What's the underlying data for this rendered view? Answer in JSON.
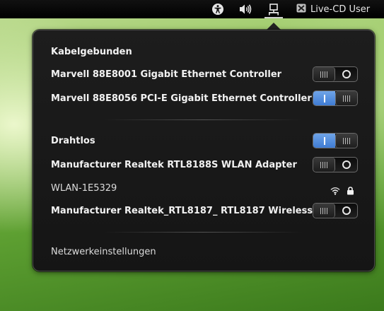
{
  "topbar": {
    "user_label": "Live-CD User"
  },
  "menu": {
    "wired_heading": "Kabelgebunden",
    "wired_devices": [
      {
        "label": "Marvell 88E8001 Gigabit Ethernet Controller",
        "enabled": false
      },
      {
        "label": "Marvell 88E8056 PCI-E Gigabit Ethernet Controller",
        "enabled": true
      }
    ],
    "wireless_heading": "Drahtlos",
    "wireless_enabled": true,
    "wireless_devices": [
      {
        "label": "Manufacturer Realtek RTL8188S WLAN Adapter",
        "enabled": false
      },
      {
        "label": "Manufacturer Realtek_RTL8187_ RTL8187 Wireless",
        "enabled": false
      }
    ],
    "network_name": "WLAN-1E5329",
    "settings_label": "Netzwerkeinstellungen"
  },
  "icons": {
    "accessibility": "accessibility-icon",
    "volume": "volume-icon",
    "network": "network-wired-icon",
    "user": "user-icon",
    "wifi_signal": "wifi-signal-icon",
    "lock": "lock-icon"
  },
  "colors": {
    "switch_on": "#4a86da",
    "menu_bg": "#1a1a1a",
    "topbar_bg": "#000000"
  }
}
